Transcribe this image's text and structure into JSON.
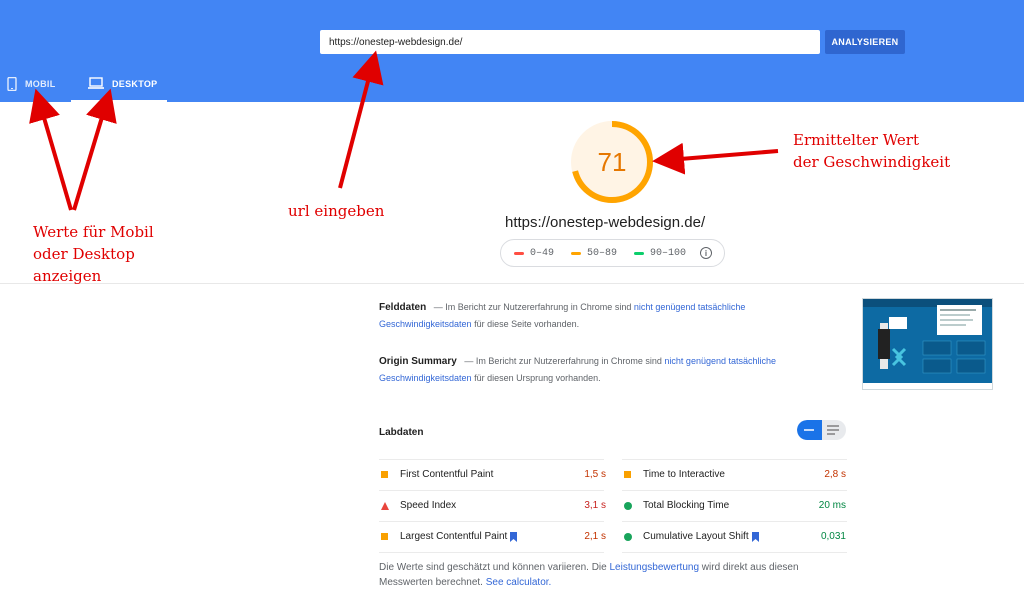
{
  "search": {
    "url_value": "https://onestep-webdesign.de/",
    "analyze_label": "ANALYSIEREN"
  },
  "tabs": [
    {
      "label": "MOBIL",
      "icon": "phone-icon"
    },
    {
      "label": "DESKTOP",
      "icon": "laptop-icon",
      "active": true
    }
  ],
  "score": {
    "value": "71",
    "fraction": 0.71,
    "color": "#ffa400"
  },
  "site_url": "https://onestep-webdesign.de/",
  "legend": [
    {
      "range": "0–49",
      "color": "#ff4e42"
    },
    {
      "range": "50–89",
      "color": "#ffa400"
    },
    {
      "range": "90–100",
      "color": "#0cce6b"
    }
  ],
  "felddaten": {
    "title": "Felddaten",
    "text_pre": "— Im Bericht zur Nutzererfahrung in Chrome sind",
    "link": "nicht genügend tatsächliche Geschwindigkeitsdaten",
    "text_post": "für diese Seite vorhanden."
  },
  "origin": {
    "title": "Origin Summary",
    "text_pre": "— Im Bericht zur Nutzererfahrung in Chrome sind",
    "link": "nicht genügend tatsächliche Geschwindigkeitsdaten",
    "text_post": "für diesen Ursprung vorhanden."
  },
  "labdaten": {
    "title": "Labdaten"
  },
  "metrics": [
    {
      "name": "First Contentful Paint",
      "value": "1,5 s",
      "status": "average",
      "flag": false
    },
    {
      "name": "Time to Interactive",
      "value": "2,8 s",
      "status": "average",
      "flag": false
    },
    {
      "name": "Speed Index",
      "value": "3,1 s",
      "status": "fail",
      "flag": false
    },
    {
      "name": "Total Blocking Time",
      "value": "20 ms",
      "status": "pass",
      "flag": false
    },
    {
      "name": "Largest Contentful Paint",
      "value": "2,1 s",
      "status": "average",
      "flag": true
    },
    {
      "name": "Cumulative Layout Shift",
      "value": "0,031",
      "status": "pass",
      "flag": true
    }
  ],
  "note": {
    "text_pre": "Die Werte sind geschätzt und können variieren. Die",
    "link1": "Leistungsbewertung",
    "text_mid": "wird direkt aus diesen Messwerten berechnet.",
    "link2": "See calculator."
  },
  "annotations": {
    "mobil_desktop": [
      "Werte für Mobil",
      "oder Desktop",
      "anzeigen"
    ],
    "url": "url eingeben",
    "wert": [
      "Ermittelter Wert",
      "der Geschwindigkeit"
    ]
  },
  "colors": {
    "header": "#4285f4",
    "average": "#c33300",
    "average_text": "#c33300",
    "pass_text": "#018642",
    "fail_text": "#c7221f",
    "annotation": "#e00000"
  }
}
